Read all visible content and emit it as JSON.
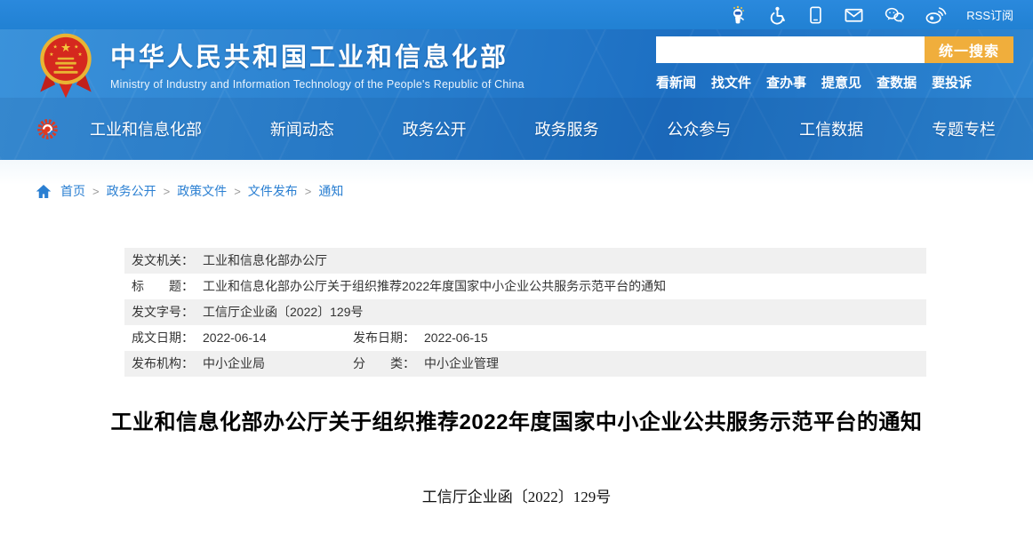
{
  "topbar": {
    "icons": [
      "assistant-robot-icon",
      "accessibility-icon",
      "mobile-icon",
      "mail-icon",
      "wechat-icon",
      "weibo-icon"
    ],
    "rss_label": "RSS订阅"
  },
  "header": {
    "site_title": "中华人民共和国工业和信息化部",
    "site_subtitle": "Ministry of Industry and Information Technology of the People's Republic of China",
    "search": {
      "value": "",
      "placeholder": "",
      "button_label": "统一搜索"
    },
    "quick_links": [
      "看新闻",
      "找文件",
      "查办事",
      "提意见",
      "查数据",
      "要投诉"
    ]
  },
  "nav": {
    "items": [
      "工业和信息化部",
      "新闻动态",
      "政务公开",
      "政务服务",
      "公众参与",
      "工信数据",
      "专题专栏"
    ]
  },
  "breadcrumb": {
    "separator": ">",
    "items": [
      "首页",
      "政务公开",
      "政策文件",
      "文件发布",
      "通知"
    ]
  },
  "doc_meta": {
    "rows": [
      {
        "cells": [
          {
            "label": "发文机关：",
            "value": "工业和信息化部办公厅"
          }
        ]
      },
      {
        "cells": [
          {
            "label": "标　　题：",
            "value": "工业和信息化部办公厅关于组织推荐2022年度国家中小企业公共服务示范平台的通知"
          }
        ]
      },
      {
        "cells": [
          {
            "label": "发文字号：",
            "value": "工信厅企业函〔2022〕129号"
          }
        ]
      },
      {
        "cells": [
          {
            "label": "成文日期：",
            "value": "2022-06-14"
          },
          {
            "label": "发布日期：",
            "value": "2022-06-15"
          }
        ]
      },
      {
        "cells": [
          {
            "label": "发布机构：",
            "value": "中小企业局"
          },
          {
            "label": "分　　类：",
            "value": "中小企业管理"
          }
        ]
      }
    ]
  },
  "article": {
    "title": "工业和信息化部办公厅关于组织推荐2022年度国家中小企业公共服务示范平台的通知",
    "doc_number": "工信厅企业函〔2022〕129号"
  },
  "colors": {
    "accent_blue": "#2181d3",
    "button_orange": "#f0ae3c",
    "emblem_red": "#d5281e",
    "emblem_gold": "#f3c73c",
    "meta_row_gray": "#f0f0f0"
  }
}
